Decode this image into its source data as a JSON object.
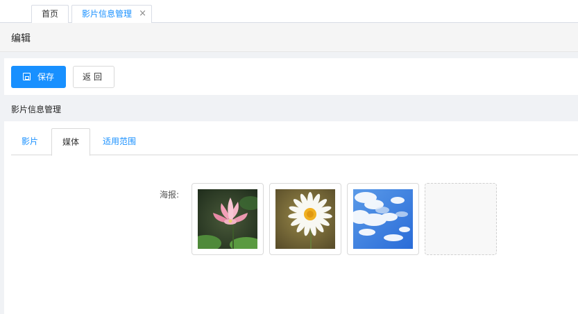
{
  "tabbar": {
    "home_label": "首页",
    "active_label": "影片信息管理",
    "close_glyph": "×"
  },
  "editbar": {
    "title": "编辑"
  },
  "toolbar": {
    "save_label": "保存",
    "back_label": "返回"
  },
  "section": {
    "title": "影片信息管理"
  },
  "subtabs": [
    {
      "label": "影片",
      "active": false
    },
    {
      "label": "媒体",
      "active": true
    },
    {
      "label": "适用范围",
      "active": false
    }
  ],
  "media": {
    "poster_label": "海报:",
    "posters": [
      {
        "subject": "pink lotus flower"
      },
      {
        "subject": "white daisy"
      },
      {
        "subject": "blue sky with clouds"
      }
    ]
  },
  "colors": {
    "primary": "#1890ff",
    "page_bg": "#f0f2f5"
  }
}
